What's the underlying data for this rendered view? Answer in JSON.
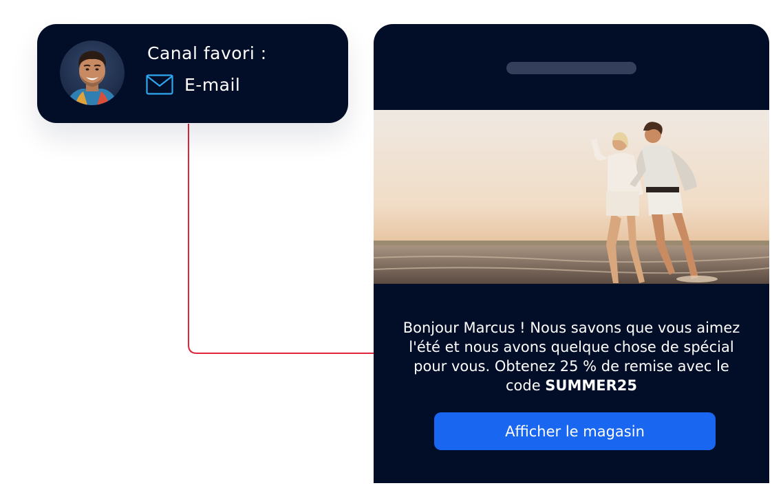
{
  "profile": {
    "channel_label": "Canal favori :",
    "channel_value": "E-mail",
    "channel_icon": "mail-icon",
    "avatar": "avatar-photo"
  },
  "email_preview": {
    "message_before_code": "Bonjour Marcus ! Nous savons que vous aimez l'été et nous avons quelque chose de spécial pour vous. Obtenez 25 % de remise avec le code ",
    "code": "SUMMER25",
    "cta_label": "Afficher le magasin",
    "hero_image": "beach-couple-photo"
  },
  "colors": {
    "card_bg": "#020d28",
    "accent": "#1967f0",
    "icon": "#2ea8f0",
    "connector": "#e0243a"
  }
}
